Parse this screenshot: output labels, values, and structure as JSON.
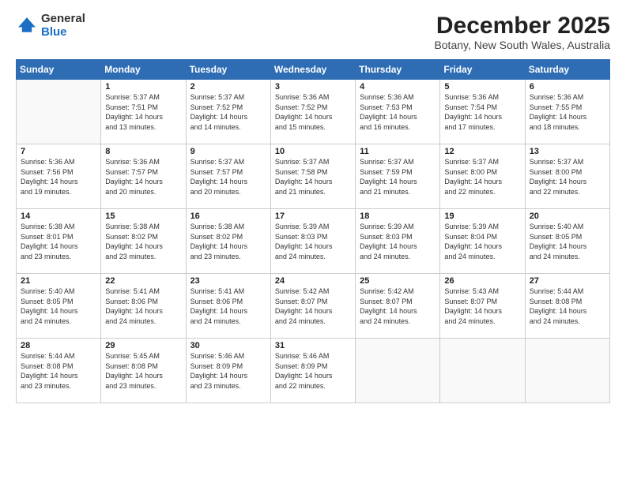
{
  "header": {
    "logo": {
      "general": "General",
      "blue": "Blue"
    },
    "title": "December 2025",
    "subtitle": "Botany, New South Wales, Australia"
  },
  "calendar": {
    "weekdays": [
      "Sunday",
      "Monday",
      "Tuesday",
      "Wednesday",
      "Thursday",
      "Friday",
      "Saturday"
    ],
    "weeks": [
      [
        {
          "day": "",
          "info": ""
        },
        {
          "day": "1",
          "info": "Sunrise: 5:37 AM\nSunset: 7:51 PM\nDaylight: 14 hours\nand 13 minutes."
        },
        {
          "day": "2",
          "info": "Sunrise: 5:37 AM\nSunset: 7:52 PM\nDaylight: 14 hours\nand 14 minutes."
        },
        {
          "day": "3",
          "info": "Sunrise: 5:36 AM\nSunset: 7:52 PM\nDaylight: 14 hours\nand 15 minutes."
        },
        {
          "day": "4",
          "info": "Sunrise: 5:36 AM\nSunset: 7:53 PM\nDaylight: 14 hours\nand 16 minutes."
        },
        {
          "day": "5",
          "info": "Sunrise: 5:36 AM\nSunset: 7:54 PM\nDaylight: 14 hours\nand 17 minutes."
        },
        {
          "day": "6",
          "info": "Sunrise: 5:36 AM\nSunset: 7:55 PM\nDaylight: 14 hours\nand 18 minutes."
        }
      ],
      [
        {
          "day": "7",
          "info": "Sunrise: 5:36 AM\nSunset: 7:56 PM\nDaylight: 14 hours\nand 19 minutes."
        },
        {
          "day": "8",
          "info": "Sunrise: 5:36 AM\nSunset: 7:57 PM\nDaylight: 14 hours\nand 20 minutes."
        },
        {
          "day": "9",
          "info": "Sunrise: 5:37 AM\nSunset: 7:57 PM\nDaylight: 14 hours\nand 20 minutes."
        },
        {
          "day": "10",
          "info": "Sunrise: 5:37 AM\nSunset: 7:58 PM\nDaylight: 14 hours\nand 21 minutes."
        },
        {
          "day": "11",
          "info": "Sunrise: 5:37 AM\nSunset: 7:59 PM\nDaylight: 14 hours\nand 21 minutes."
        },
        {
          "day": "12",
          "info": "Sunrise: 5:37 AM\nSunset: 8:00 PM\nDaylight: 14 hours\nand 22 minutes."
        },
        {
          "day": "13",
          "info": "Sunrise: 5:37 AM\nSunset: 8:00 PM\nDaylight: 14 hours\nand 22 minutes."
        }
      ],
      [
        {
          "day": "14",
          "info": "Sunrise: 5:38 AM\nSunset: 8:01 PM\nDaylight: 14 hours\nand 23 minutes."
        },
        {
          "day": "15",
          "info": "Sunrise: 5:38 AM\nSunset: 8:02 PM\nDaylight: 14 hours\nand 23 minutes."
        },
        {
          "day": "16",
          "info": "Sunrise: 5:38 AM\nSunset: 8:02 PM\nDaylight: 14 hours\nand 23 minutes."
        },
        {
          "day": "17",
          "info": "Sunrise: 5:39 AM\nSunset: 8:03 PM\nDaylight: 14 hours\nand 24 minutes."
        },
        {
          "day": "18",
          "info": "Sunrise: 5:39 AM\nSunset: 8:03 PM\nDaylight: 14 hours\nand 24 minutes."
        },
        {
          "day": "19",
          "info": "Sunrise: 5:39 AM\nSunset: 8:04 PM\nDaylight: 14 hours\nand 24 minutes."
        },
        {
          "day": "20",
          "info": "Sunrise: 5:40 AM\nSunset: 8:05 PM\nDaylight: 14 hours\nand 24 minutes."
        }
      ],
      [
        {
          "day": "21",
          "info": "Sunrise: 5:40 AM\nSunset: 8:05 PM\nDaylight: 14 hours\nand 24 minutes."
        },
        {
          "day": "22",
          "info": "Sunrise: 5:41 AM\nSunset: 8:06 PM\nDaylight: 14 hours\nand 24 minutes."
        },
        {
          "day": "23",
          "info": "Sunrise: 5:41 AM\nSunset: 8:06 PM\nDaylight: 14 hours\nand 24 minutes."
        },
        {
          "day": "24",
          "info": "Sunrise: 5:42 AM\nSunset: 8:07 PM\nDaylight: 14 hours\nand 24 minutes."
        },
        {
          "day": "25",
          "info": "Sunrise: 5:42 AM\nSunset: 8:07 PM\nDaylight: 14 hours\nand 24 minutes."
        },
        {
          "day": "26",
          "info": "Sunrise: 5:43 AM\nSunset: 8:07 PM\nDaylight: 14 hours\nand 24 minutes."
        },
        {
          "day": "27",
          "info": "Sunrise: 5:44 AM\nSunset: 8:08 PM\nDaylight: 14 hours\nand 24 minutes."
        }
      ],
      [
        {
          "day": "28",
          "info": "Sunrise: 5:44 AM\nSunset: 8:08 PM\nDaylight: 14 hours\nand 23 minutes."
        },
        {
          "day": "29",
          "info": "Sunrise: 5:45 AM\nSunset: 8:08 PM\nDaylight: 14 hours\nand 23 minutes."
        },
        {
          "day": "30",
          "info": "Sunrise: 5:46 AM\nSunset: 8:09 PM\nDaylight: 14 hours\nand 23 minutes."
        },
        {
          "day": "31",
          "info": "Sunrise: 5:46 AM\nSunset: 8:09 PM\nDaylight: 14 hours\nand 22 minutes."
        },
        {
          "day": "",
          "info": ""
        },
        {
          "day": "",
          "info": ""
        },
        {
          "day": "",
          "info": ""
        }
      ]
    ]
  }
}
